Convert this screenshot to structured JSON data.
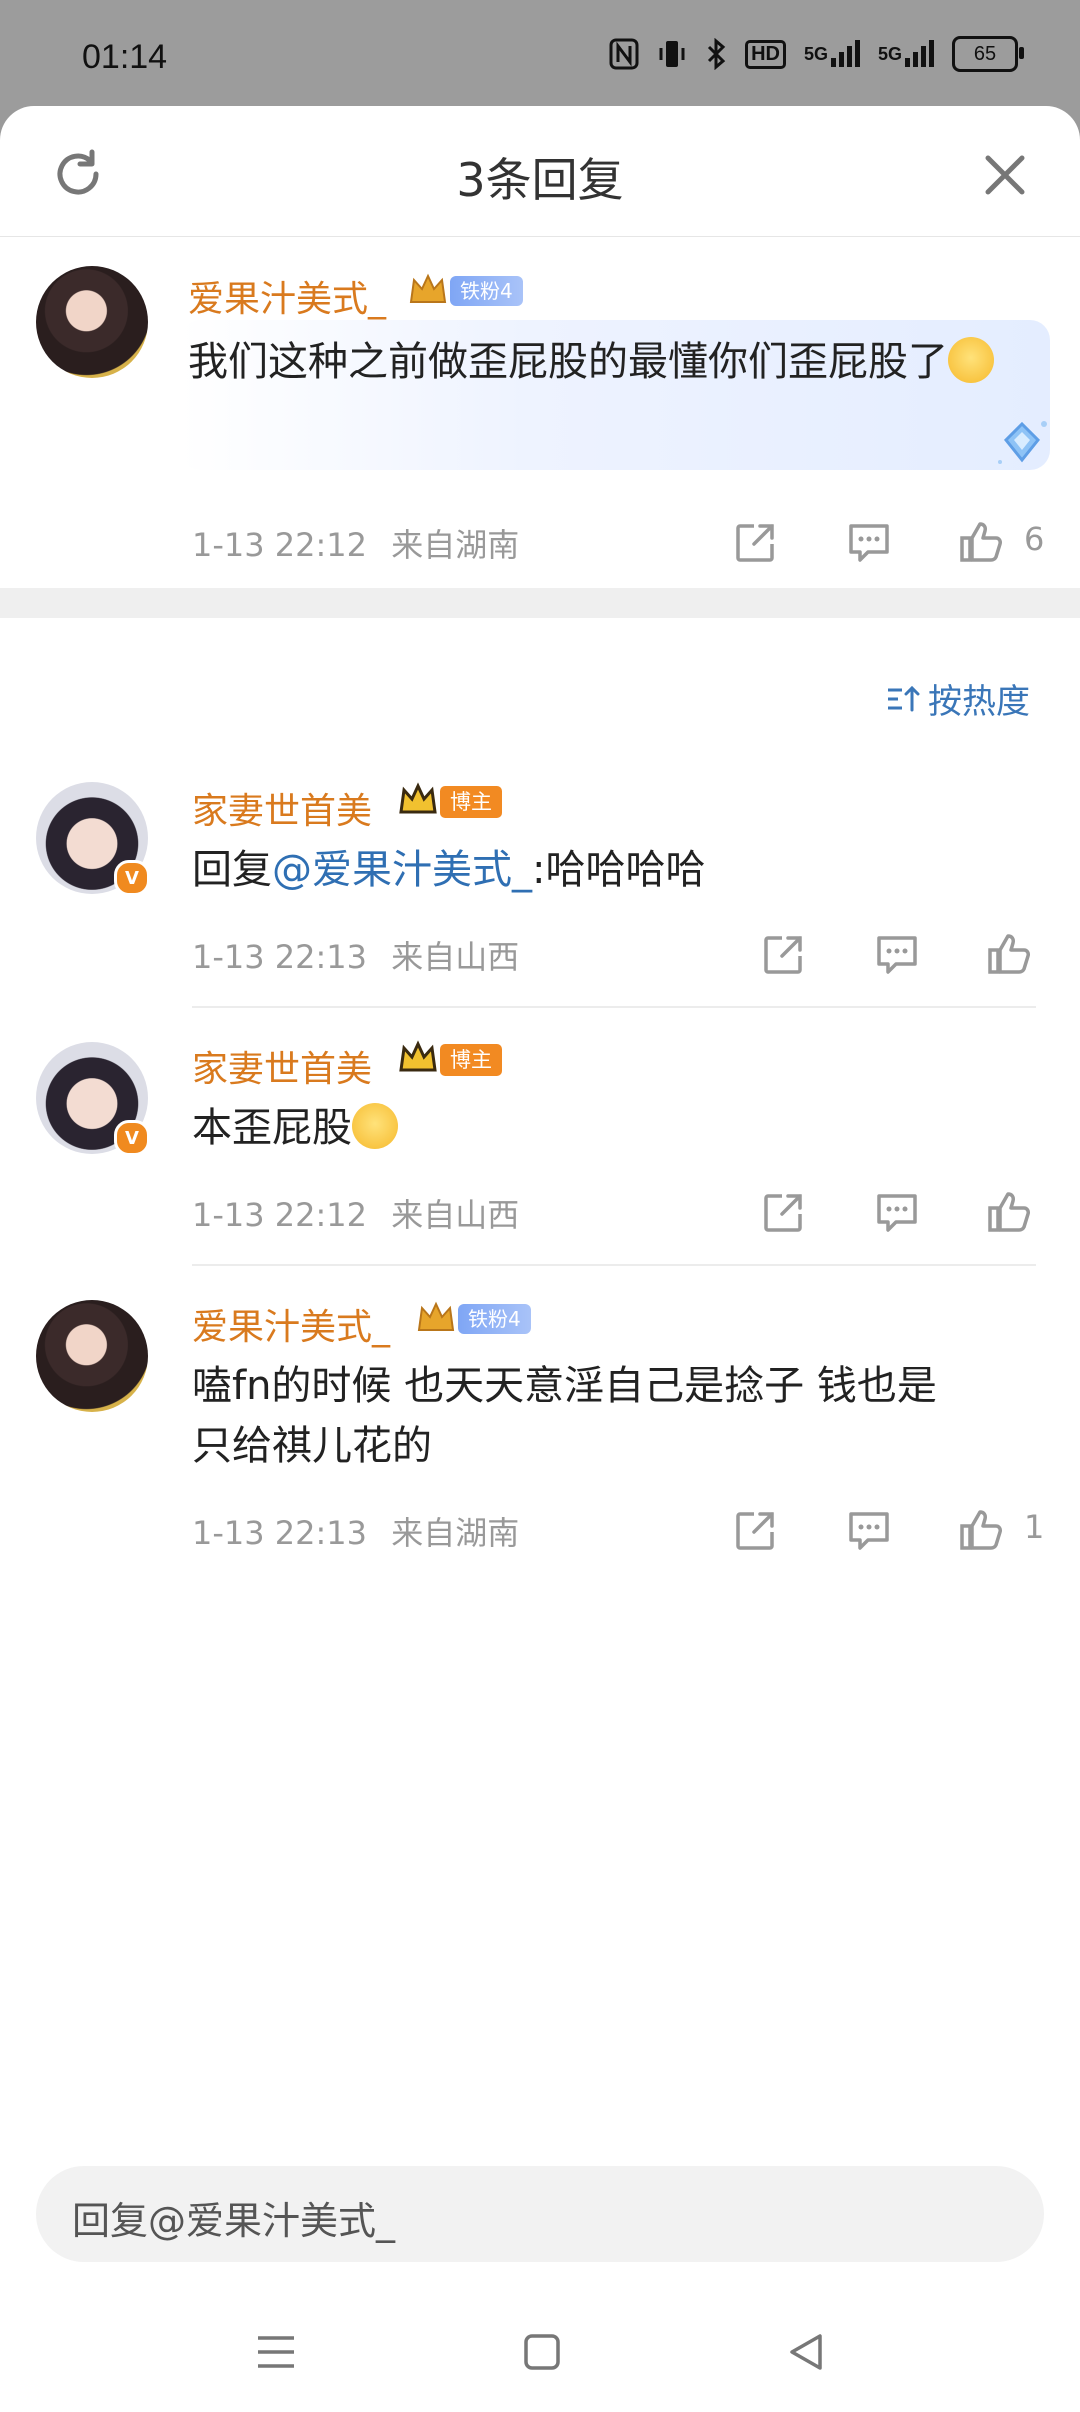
{
  "status_bar": {
    "time": "01:14",
    "icons": [
      "nfc-icon",
      "vibrate-icon",
      "bluetooth-icon",
      "hd-icon",
      "signal-5g-icon",
      "signal-5g-icon"
    ],
    "hd_label": "HD",
    "net1": "5G",
    "net2": "5G",
    "battery": "65"
  },
  "header": {
    "title": "3条回复"
  },
  "root_comment": {
    "username": "爱果汁美式_",
    "fan_badge": "铁粉4",
    "text": "我们这种之前做歪屁股的最懂你们歪屁股了",
    "time": "1-13 22:12",
    "location": "来自湖南",
    "likes": "6"
  },
  "sort": {
    "label": "按热度"
  },
  "replies": [
    {
      "username": "家妻世首美",
      "badge": "博主",
      "reply_prefix": "回复",
      "mention": "@爱果汁美式_",
      "text": ":哈哈哈哈",
      "time": "1-13 22:13",
      "location": "来自山西",
      "likes": ""
    },
    {
      "username": "家妻世首美",
      "badge": "博主",
      "text": "本歪屁股",
      "time": "1-13 22:12",
      "location": "来自山西",
      "likes": ""
    },
    {
      "username": "爱果汁美式_",
      "badge": "铁粉4",
      "text_line1": "嗑fn的时候 也天天意淫自己是捻子 钱也是",
      "text_line2": "只给祺儿花的",
      "time": "1-13 22:13",
      "location": "来自湖南",
      "likes": "1"
    }
  ],
  "reply_input": {
    "placeholder": "回复@爱果汁美式_"
  },
  "colors": {
    "username": "#d97a1e",
    "mention": "#2f6fb3",
    "sort": "#3a76b8",
    "host_badge": "#f28a22",
    "fan_badge": "#7fa6f5"
  }
}
